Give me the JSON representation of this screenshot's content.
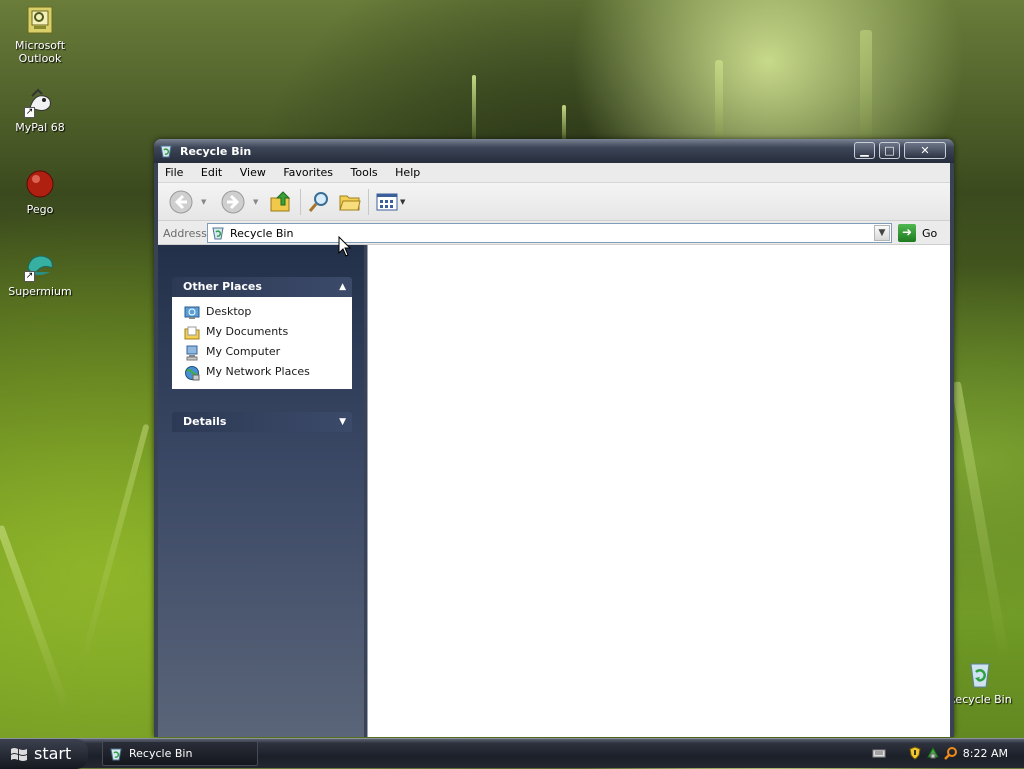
{
  "desktop": {
    "icons": [
      {
        "label": "Microsoft Outlook"
      },
      {
        "label": "MyPal 68"
      },
      {
        "label": "Pego"
      },
      {
        "label": "Supermium"
      },
      {
        "label": "Recycle Bin"
      }
    ]
  },
  "window": {
    "title": "Recycle Bin",
    "menu": [
      "File",
      "Edit",
      "View",
      "Favorites",
      "Tools",
      "Help"
    ],
    "address": {
      "label": "Address",
      "value": "Recycle Bin",
      "go_label": "Go"
    },
    "taskpane": {
      "other_places": {
        "title": "Other Places",
        "items": [
          "Desktop",
          "My Documents",
          "My Computer",
          "My Network Places"
        ]
      },
      "details": {
        "title": "Details"
      }
    }
  },
  "taskbar": {
    "start_label": "start",
    "tasks": [
      {
        "label": "Recycle Bin"
      }
    ],
    "clock": "8:22 AM"
  }
}
